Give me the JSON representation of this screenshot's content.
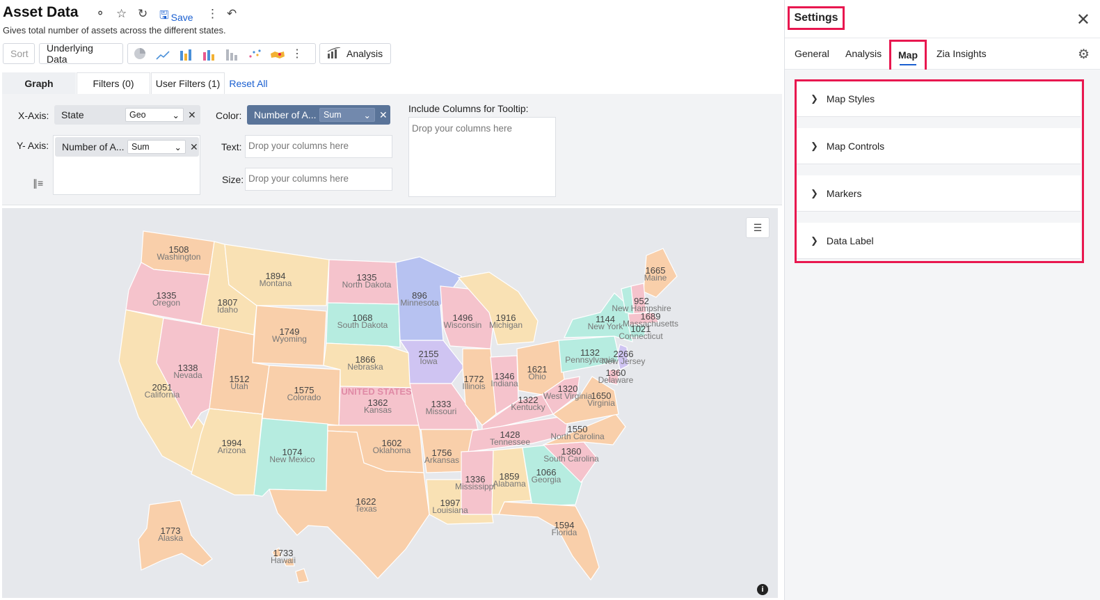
{
  "header": {
    "title": "Asset Data",
    "subtitle": "Gives total number of assets across the different states.",
    "save_label": "Save"
  },
  "toolbar": {
    "sort_label": "Sort",
    "underlying_label": "Underlying Data",
    "analysis_label": "Analysis"
  },
  "config_tabs": {
    "graph": "Graph",
    "filters": "Filters  (0)",
    "user_filters": "User Filters  (1)",
    "reset": "Reset All"
  },
  "shelf": {
    "x_axis_label": "X-Axis:",
    "x_value": "State",
    "x_type": "Geo",
    "y_axis_label": "Y- Axis:",
    "y_value": "Number of A...",
    "y_agg": "Sum",
    "color_label": "Color:",
    "color_value": "Number of A...",
    "color_agg": "Sum",
    "text_label": "Text:",
    "size_label": "Size:",
    "drop_placeholder": "Drop your columns here",
    "tooltip_label": "Include Columns for Tooltip:"
  },
  "map": {
    "country_label": "UNITED STATES"
  },
  "states": [
    {
      "name": "Washington",
      "value": "1508"
    },
    {
      "name": "Oregon",
      "value": "1335"
    },
    {
      "name": "California",
      "value": "2051"
    },
    {
      "name": "Nevada",
      "value": "1338"
    },
    {
      "name": "Idaho",
      "value": "1807"
    },
    {
      "name": "Montana",
      "value": "1894"
    },
    {
      "name": "Wyoming",
      "value": "1749"
    },
    {
      "name": "Utah",
      "value": "1512"
    },
    {
      "name": "Arizona",
      "value": "1994"
    },
    {
      "name": "Colorado",
      "value": "1575"
    },
    {
      "name": "New Mexico",
      "value": "1074"
    },
    {
      "name": "North Dakota",
      "value": "1335"
    },
    {
      "name": "South Dakota",
      "value": "1068"
    },
    {
      "name": "Nebraska",
      "value": "1866"
    },
    {
      "name": "Kansas",
      "value": "1362"
    },
    {
      "name": "Oklahoma",
      "value": "1602"
    },
    {
      "name": "Texas",
      "value": "1622"
    },
    {
      "name": "Minnesota",
      "value": "896"
    },
    {
      "name": "Iowa",
      "value": "2155"
    },
    {
      "name": "Missouri",
      "value": "1333"
    },
    {
      "name": "Arkansas",
      "value": "1756"
    },
    {
      "name": "Louisiana",
      "value": "1997"
    },
    {
      "name": "Wisconsin",
      "value": "1496"
    },
    {
      "name": "Illinois",
      "value": "1772"
    },
    {
      "name": "Michigan",
      "value": "1916"
    },
    {
      "name": "Indiana",
      "value": "1346"
    },
    {
      "name": "Ohio",
      "value": "1621"
    },
    {
      "name": "Kentucky",
      "value": "1322"
    },
    {
      "name": "Tennessee",
      "value": "1428"
    },
    {
      "name": "Mississippi",
      "value": "1336"
    },
    {
      "name": "Alabama",
      "value": "1859"
    },
    {
      "name": "Georgia",
      "value": "1066"
    },
    {
      "name": "Florida",
      "value": "1594"
    },
    {
      "name": "South Carolina",
      "value": "1360"
    },
    {
      "name": "North Carolina",
      "value": "1550"
    },
    {
      "name": "Virginia",
      "value": "1650"
    },
    {
      "name": "West Virginia",
      "value": "1320"
    },
    {
      "name": "Pennsylvania",
      "value": "1132"
    },
    {
      "name": "New York",
      "value": "1144"
    },
    {
      "name": "Maine",
      "value": "1665"
    },
    {
      "name": "New Hampshire",
      "value": "952"
    },
    {
      "name": "Massachusetts",
      "value": "1689"
    },
    {
      "name": "Connecticut",
      "value": "1021"
    },
    {
      "name": "New Jersey",
      "value": "2266"
    },
    {
      "name": "Delaware",
      "value": "1360"
    },
    {
      "name": "Alaska",
      "value": "1773"
    },
    {
      "name": "Hawaii",
      "value": "1733"
    }
  ],
  "settings": {
    "title": "Settings",
    "tabs": {
      "general": "General",
      "analysis": "Analysis",
      "map": "Map",
      "zia": "Zia Insights"
    },
    "sections": {
      "map_styles": "Map Styles",
      "map_controls": "Map Controls",
      "markers": "Markers",
      "data_label": "Data Label"
    }
  },
  "colors": {
    "pink": "#f5c3cc",
    "peach": "#f9cfaa",
    "cream": "#f9e1b4",
    "mint": "#b6ece0",
    "blue": "#b7c2f1",
    "lavender": "#cfc4f2",
    "highlight": "#e8174f",
    "accent": "#1a5fd0"
  }
}
